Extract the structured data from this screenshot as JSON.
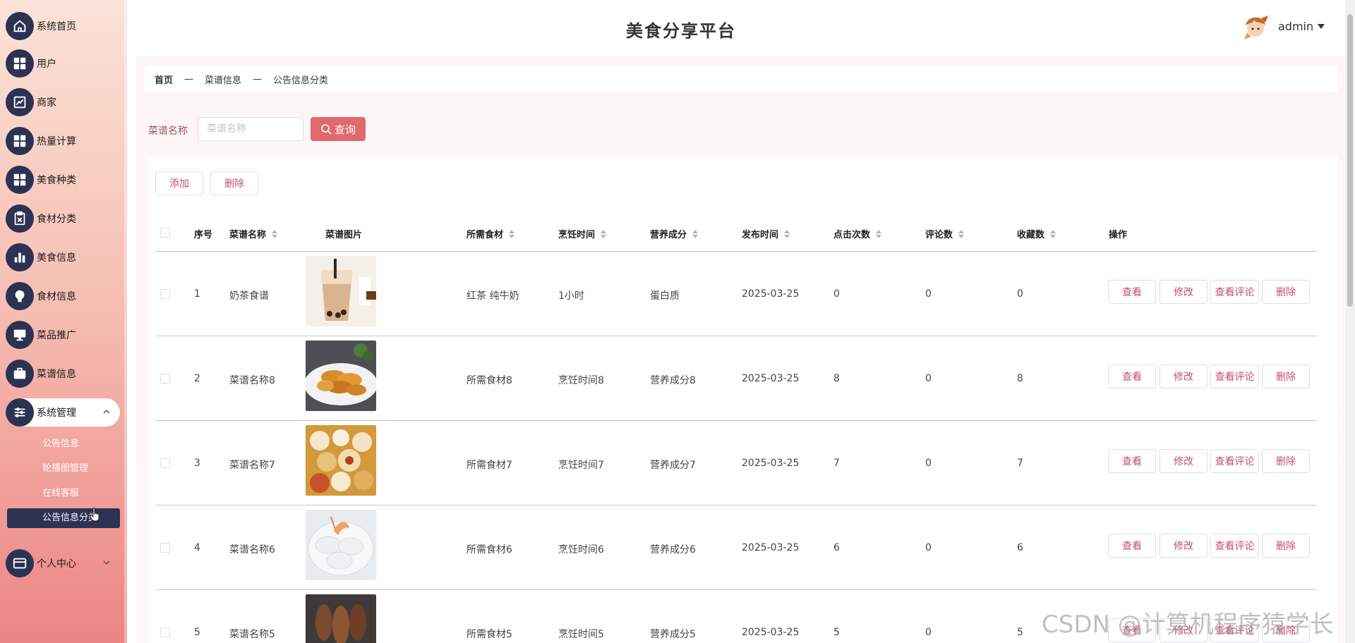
{
  "header": {
    "title": "美食分享平台",
    "username": "admin"
  },
  "sidebar": {
    "items": [
      {
        "label": "系统首页",
        "icon": "home-icon"
      },
      {
        "label": "用户",
        "icon": "grid-icon"
      },
      {
        "label": "商家",
        "icon": "trend-chart-icon"
      },
      {
        "label": "热量计算",
        "icon": "grid-icon"
      },
      {
        "label": "美食种类",
        "icon": "grid-icon"
      },
      {
        "label": "食材分类",
        "icon": "clipboard-icon"
      },
      {
        "label": "美食信息",
        "icon": "bar-chart-icon"
      },
      {
        "label": "食材信息",
        "icon": "bulb-icon"
      },
      {
        "label": "菜品推广",
        "icon": "monitor-icon"
      },
      {
        "label": "菜谱信息",
        "icon": "briefcase-icon"
      },
      {
        "label": "系统管理",
        "icon": "sliders-icon"
      }
    ],
    "system_sub": [
      "公告信息",
      "轮播图管理",
      "在线客服",
      "公告信息分类"
    ],
    "personal": {
      "label": "个人中心",
      "icon": "wallet-icon"
    }
  },
  "breadcrumb": [
    "首页",
    "菜谱信息",
    "公告信息分类"
  ],
  "breadcrumb_sep": "—",
  "search": {
    "label": "菜谱名称",
    "placeholder": "菜谱名称",
    "button": "查询"
  },
  "toolbar": {
    "add": "添加",
    "delete": "删除"
  },
  "table": {
    "columns": [
      "序号",
      "菜谱名称",
      "菜谱图片",
      "所需食材",
      "烹饪时间",
      "营养成分",
      "发布时间",
      "点击次数",
      "评论数",
      "收藏数",
      "操作"
    ],
    "rows": [
      {
        "idx": "1",
        "name": "奶茶食谱",
        "ingredients": "红茶 纯牛奶",
        "time": "1小时",
        "nutrition": "蛋白质",
        "date": "2025-03-25",
        "clicks": "0",
        "comments": "0",
        "favorites": "0"
      },
      {
        "idx": "2",
        "name": "菜谱名称8",
        "ingredients": "所需食材8",
        "time": "烹饪时间8",
        "nutrition": "营养成分8",
        "date": "2025-03-25",
        "clicks": "8",
        "comments": "0",
        "favorites": "8"
      },
      {
        "idx": "3",
        "name": "菜谱名称7",
        "ingredients": "所需食材7",
        "time": "烹饪时间7",
        "nutrition": "营养成分7",
        "date": "2025-03-25",
        "clicks": "7",
        "comments": "0",
        "favorites": "7"
      },
      {
        "idx": "4",
        "name": "菜谱名称6",
        "ingredients": "所需食材6",
        "time": "烹饪时间6",
        "nutrition": "营养成分6",
        "date": "2025-03-25",
        "clicks": "6",
        "comments": "0",
        "favorites": "6"
      },
      {
        "idx": "5",
        "name": "菜谱名称5",
        "ingredients": "所需食材5",
        "time": "烹饪时间5",
        "nutrition": "营养成分5",
        "date": "2025-03-25",
        "clicks": "5",
        "comments": "0",
        "favorites": "5"
      }
    ],
    "actions": [
      "查看",
      "修改",
      "查看评论",
      "删除"
    ]
  },
  "watermark": "CSDN @计算机程序猿学长",
  "colors": {
    "accent": "#e0686e",
    "nav_dark": "#2b3252",
    "action_text": "#c4506a"
  }
}
